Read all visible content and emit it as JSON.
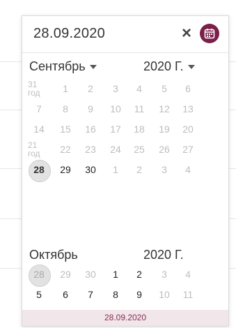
{
  "input": {
    "value": "28.09.2020",
    "clear_label": "×"
  },
  "calendar_icon": "calendar-icon",
  "header": {
    "month": "Сентябрь",
    "year": "2020 Г."
  },
  "september_weeks": [
    {
      "label_top": "31",
      "label_bottom": "год",
      "days": [
        "1",
        "2",
        "3",
        "4",
        "5",
        "6"
      ],
      "active": [
        0,
        0,
        0,
        0,
        0,
        0
      ]
    },
    {
      "days": [
        "7",
        "8",
        "9",
        "10",
        "11",
        "12",
        "13"
      ],
      "active": [
        0,
        0,
        0,
        0,
        0,
        0,
        0
      ]
    },
    {
      "days": [
        "14",
        "15",
        "16",
        "17",
        "18",
        "19",
        "20"
      ],
      "active": [
        0,
        0,
        0,
        0,
        0,
        0,
        0
      ]
    },
    {
      "label_top": "21",
      "label_bottom": "год",
      "days": [
        "22",
        "23",
        "24",
        "25",
        "26",
        "27"
      ],
      "active": [
        0,
        0,
        0,
        0,
        0,
        0
      ]
    },
    {
      "days": [
        "28",
        "29",
        "30",
        "1",
        "2",
        "3",
        "4"
      ],
      "active": [
        1,
        1,
        1,
        0,
        0,
        0,
        0
      ],
      "selected_index": 0
    }
  ],
  "october": {
    "month": "Октябрь",
    "year": "2020 Г."
  },
  "october_weeks": [
    {
      "days": [
        "28",
        "29",
        "30",
        "1",
        "2",
        "3",
        "4"
      ],
      "active": [
        0,
        0,
        0,
        1,
        1,
        0,
        0
      ],
      "selected_index": 0
    },
    {
      "days": [
        "5",
        "6",
        "7",
        "8",
        "9",
        "10",
        "11"
      ],
      "active": [
        1,
        1,
        1,
        1,
        1,
        0,
        0
      ]
    }
  ],
  "footer": {
    "date": "28.09.2020"
  },
  "colors": {
    "accent": "#7a1f4a",
    "footer_bg": "#f1e6e9",
    "muted": "#bdbdbd"
  }
}
